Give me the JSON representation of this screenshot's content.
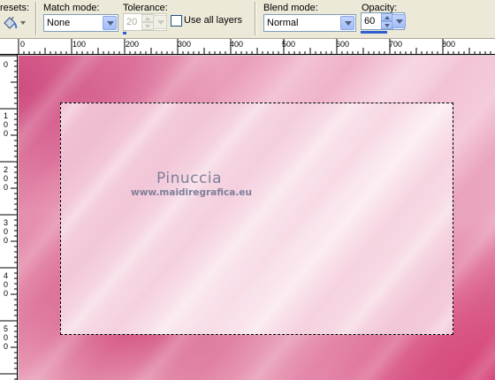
{
  "toolbar": {
    "presets_label": "resets:",
    "match_mode_label": "Match mode:",
    "match_mode_value": "None",
    "tolerance_label": "Tolerance:",
    "tolerance_value": "20",
    "use_all_layers_label": "Use all layers",
    "use_all_layers_checked": false,
    "blend_mode_label": "Blend mode:",
    "blend_mode_value": "Normal",
    "opacity_label": "Opacity:",
    "opacity_value": "60"
  },
  "ruler_top": {
    "marks": [
      {
        "label": "0"
      },
      {
        "label": "100"
      },
      {
        "label": "200"
      },
      {
        "label": "300"
      },
      {
        "label": "400"
      },
      {
        "label": "500"
      },
      {
        "label": "600"
      },
      {
        "label": "700"
      },
      {
        "label": "800"
      }
    ]
  },
  "ruler_left": {
    "marks": [
      {
        "label": "0"
      },
      {
        "label": "100"
      },
      {
        "label": "200"
      },
      {
        "label": "300"
      },
      {
        "label": "400"
      },
      {
        "label": "500"
      }
    ]
  },
  "watermark": {
    "title": "Pinuccia",
    "url": "www.maidiregrafica.eu"
  },
  "colors": {
    "accent": "#2f5fd0",
    "canvas_pink": "#e07aa0",
    "watermark": "#7f7f9a"
  },
  "icons": {
    "presets": "fill-bucket-icon"
  }
}
